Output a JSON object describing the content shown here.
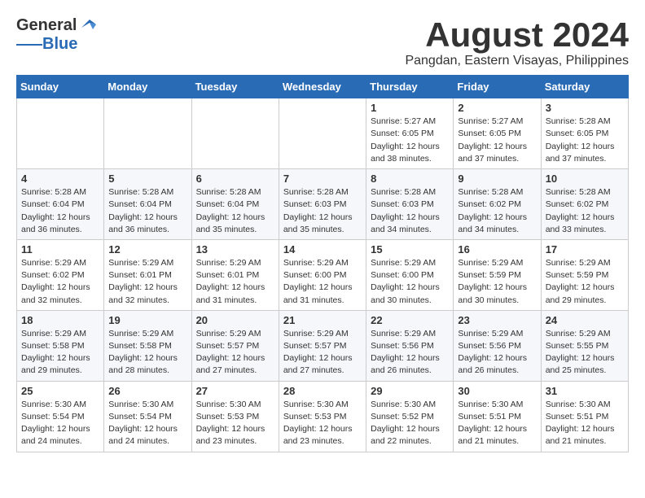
{
  "logo": {
    "line1": "General",
    "line2": "Blue"
  },
  "title": "August 2024",
  "subtitle": "Pangdan, Eastern Visayas, Philippines",
  "weekdays": [
    "Sunday",
    "Monday",
    "Tuesday",
    "Wednesday",
    "Thursday",
    "Friday",
    "Saturday"
  ],
  "weeks": [
    [
      {
        "day": "",
        "info": ""
      },
      {
        "day": "",
        "info": ""
      },
      {
        "day": "",
        "info": ""
      },
      {
        "day": "",
        "info": ""
      },
      {
        "day": "1",
        "info": "Sunrise: 5:27 AM\nSunset: 6:05 PM\nDaylight: 12 hours\nand 38 minutes."
      },
      {
        "day": "2",
        "info": "Sunrise: 5:27 AM\nSunset: 6:05 PM\nDaylight: 12 hours\nand 37 minutes."
      },
      {
        "day": "3",
        "info": "Sunrise: 5:28 AM\nSunset: 6:05 PM\nDaylight: 12 hours\nand 37 minutes."
      }
    ],
    [
      {
        "day": "4",
        "info": "Sunrise: 5:28 AM\nSunset: 6:04 PM\nDaylight: 12 hours\nand 36 minutes."
      },
      {
        "day": "5",
        "info": "Sunrise: 5:28 AM\nSunset: 6:04 PM\nDaylight: 12 hours\nand 36 minutes."
      },
      {
        "day": "6",
        "info": "Sunrise: 5:28 AM\nSunset: 6:04 PM\nDaylight: 12 hours\nand 35 minutes."
      },
      {
        "day": "7",
        "info": "Sunrise: 5:28 AM\nSunset: 6:03 PM\nDaylight: 12 hours\nand 35 minutes."
      },
      {
        "day": "8",
        "info": "Sunrise: 5:28 AM\nSunset: 6:03 PM\nDaylight: 12 hours\nand 34 minutes."
      },
      {
        "day": "9",
        "info": "Sunrise: 5:28 AM\nSunset: 6:02 PM\nDaylight: 12 hours\nand 34 minutes."
      },
      {
        "day": "10",
        "info": "Sunrise: 5:28 AM\nSunset: 6:02 PM\nDaylight: 12 hours\nand 33 minutes."
      }
    ],
    [
      {
        "day": "11",
        "info": "Sunrise: 5:29 AM\nSunset: 6:02 PM\nDaylight: 12 hours\nand 32 minutes."
      },
      {
        "day": "12",
        "info": "Sunrise: 5:29 AM\nSunset: 6:01 PM\nDaylight: 12 hours\nand 32 minutes."
      },
      {
        "day": "13",
        "info": "Sunrise: 5:29 AM\nSunset: 6:01 PM\nDaylight: 12 hours\nand 31 minutes."
      },
      {
        "day": "14",
        "info": "Sunrise: 5:29 AM\nSunset: 6:00 PM\nDaylight: 12 hours\nand 31 minutes."
      },
      {
        "day": "15",
        "info": "Sunrise: 5:29 AM\nSunset: 6:00 PM\nDaylight: 12 hours\nand 30 minutes."
      },
      {
        "day": "16",
        "info": "Sunrise: 5:29 AM\nSunset: 5:59 PM\nDaylight: 12 hours\nand 30 minutes."
      },
      {
        "day": "17",
        "info": "Sunrise: 5:29 AM\nSunset: 5:59 PM\nDaylight: 12 hours\nand 29 minutes."
      }
    ],
    [
      {
        "day": "18",
        "info": "Sunrise: 5:29 AM\nSunset: 5:58 PM\nDaylight: 12 hours\nand 29 minutes."
      },
      {
        "day": "19",
        "info": "Sunrise: 5:29 AM\nSunset: 5:58 PM\nDaylight: 12 hours\nand 28 minutes."
      },
      {
        "day": "20",
        "info": "Sunrise: 5:29 AM\nSunset: 5:57 PM\nDaylight: 12 hours\nand 27 minutes."
      },
      {
        "day": "21",
        "info": "Sunrise: 5:29 AM\nSunset: 5:57 PM\nDaylight: 12 hours\nand 27 minutes."
      },
      {
        "day": "22",
        "info": "Sunrise: 5:29 AM\nSunset: 5:56 PM\nDaylight: 12 hours\nand 26 minutes."
      },
      {
        "day": "23",
        "info": "Sunrise: 5:29 AM\nSunset: 5:56 PM\nDaylight: 12 hours\nand 26 minutes."
      },
      {
        "day": "24",
        "info": "Sunrise: 5:29 AM\nSunset: 5:55 PM\nDaylight: 12 hours\nand 25 minutes."
      }
    ],
    [
      {
        "day": "25",
        "info": "Sunrise: 5:30 AM\nSunset: 5:54 PM\nDaylight: 12 hours\nand 24 minutes."
      },
      {
        "day": "26",
        "info": "Sunrise: 5:30 AM\nSunset: 5:54 PM\nDaylight: 12 hours\nand 24 minutes."
      },
      {
        "day": "27",
        "info": "Sunrise: 5:30 AM\nSunset: 5:53 PM\nDaylight: 12 hours\nand 23 minutes."
      },
      {
        "day": "28",
        "info": "Sunrise: 5:30 AM\nSunset: 5:53 PM\nDaylight: 12 hours\nand 23 minutes."
      },
      {
        "day": "29",
        "info": "Sunrise: 5:30 AM\nSunset: 5:52 PM\nDaylight: 12 hours\nand 22 minutes."
      },
      {
        "day": "30",
        "info": "Sunrise: 5:30 AM\nSunset: 5:51 PM\nDaylight: 12 hours\nand 21 minutes."
      },
      {
        "day": "31",
        "info": "Sunrise: 5:30 AM\nSunset: 5:51 PM\nDaylight: 12 hours\nand 21 minutes."
      }
    ]
  ]
}
